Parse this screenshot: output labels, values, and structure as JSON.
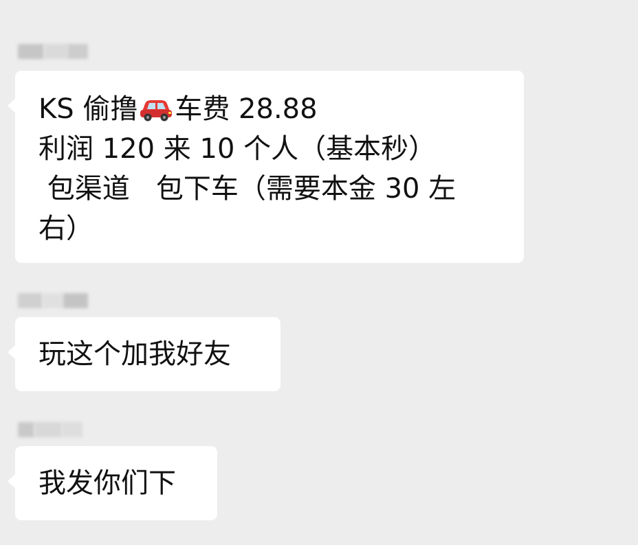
{
  "messages": [
    {
      "sender_name": "",
      "lines": [
        {
          "before": "KS 偷撸",
          "icon": "red-car-icon",
          "after": "车费 28.88"
        },
        {
          "text": "利润 120 来 10 个人（基本秒）"
        },
        {
          "text": " 包渠道   包下车（需要本金 30 左"
        },
        {
          "text": "右）"
        }
      ]
    },
    {
      "sender_name": "",
      "lines": [
        {
          "text": "玩这个加我好友"
        }
      ]
    },
    {
      "sender_name": "",
      "lines": [
        {
          "text": "我发你们下"
        }
      ]
    }
  ],
  "colors": {
    "background": "#ededed",
    "bubble": "#ffffff",
    "text": "#111111",
    "car": "#e53935"
  }
}
